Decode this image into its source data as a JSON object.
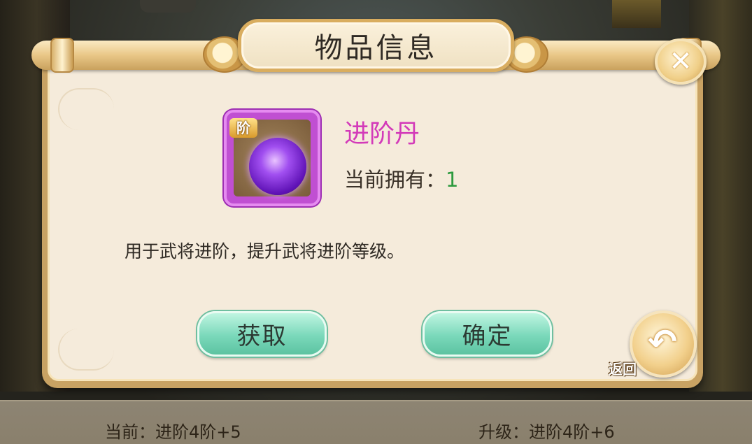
{
  "dialog": {
    "title": "物品信息",
    "close_icon": "close-icon"
  },
  "item": {
    "name": "进阶丹",
    "grade_badge": "阶",
    "owned_label": "当前拥有：",
    "owned_count": "1",
    "description": "用于武将进阶，提升武将进阶等级。",
    "icon": "purple-orb-icon"
  },
  "buttons": {
    "acquire_label": "获取",
    "confirm_label": "确定",
    "return_label": "返回"
  },
  "status": {
    "current": "当前：进阶4阶+5",
    "upgrade": "升级：进阶4阶+6"
  },
  "colors": {
    "item_name": "#d33ab9",
    "owned_count": "#2d9a3e",
    "button": "#7ad8ba",
    "frame": "#c8a263"
  }
}
